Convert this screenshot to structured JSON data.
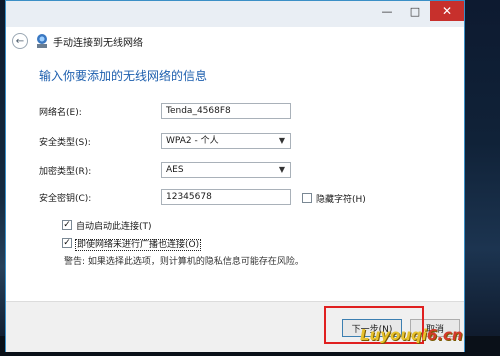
{
  "window": {
    "title": "手动连接到无线网络",
    "controls": {
      "minimize": "—",
      "maximize": "□",
      "close": "✕"
    }
  },
  "heading": "输入你要添加的无线网络的信息",
  "form": {
    "network_name_label": "网络名(E):",
    "network_name_value": "Tenda_4568F8",
    "security_type_label": "安全类型(S):",
    "security_type_value": "WPA2 - 个人",
    "encryption_type_label": "加密类型(R):",
    "encryption_type_value": "AES",
    "security_key_label": "安全密钥(C):",
    "security_key_value": "12345678",
    "hide_chars_label": "隐藏字符(H)",
    "hide_chars_checked": false
  },
  "options": {
    "auto_connect_label": "自动启动此连接(T)",
    "auto_connect_checked": true,
    "connect_hidden_label": "即使网络未进行广播也连接(O)",
    "connect_hidden_checked": true,
    "warning": "警告: 如果选择此选项，则计算机的隐私信息可能存在风险。"
  },
  "buttons": {
    "next": "下一步(N)",
    "cancel": "取消"
  },
  "watermark": {
    "main": "Luyouqi",
    "tail": "6.cn"
  },
  "icons": {
    "back": "back-arrow-icon",
    "network": "wireless-network-icon",
    "chevron": "chevron-down-icon"
  },
  "colors": {
    "heading": "#1d5fae",
    "close_button": "#c7302c",
    "highlight_box": "#e02020",
    "window_border": "#3b8fc6"
  }
}
